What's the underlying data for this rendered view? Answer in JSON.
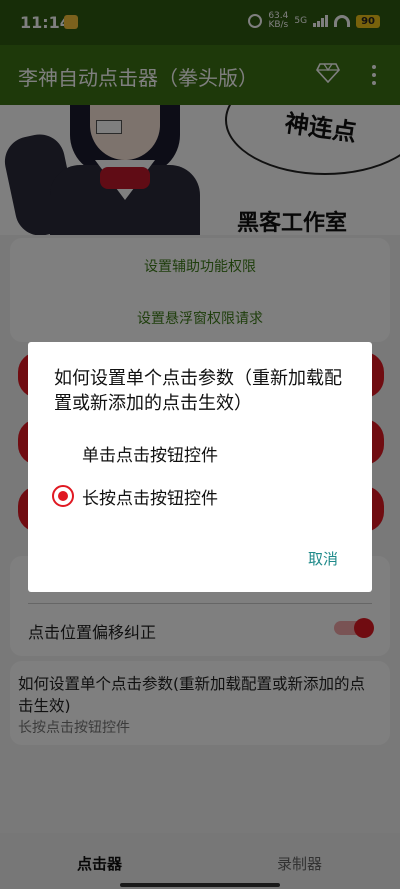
{
  "status_bar": {
    "time": "11:14",
    "speed": "63.4",
    "speed_unit": "KB/s",
    "network": "5G",
    "battery": "90"
  },
  "appbar": {
    "title": "李神自动点击器（拳头版）",
    "icons": [
      "diamond-icon",
      "more-vert-icon"
    ]
  },
  "banner": {
    "bubble_text": "神连点",
    "studio_text": "黑客工作室"
  },
  "permissions": {
    "accessibility": "设置辅助功能权限",
    "overlay": "设置悬浮窗权限请求"
  },
  "settings": {
    "offset_label": "点击位置偏移纠正",
    "offset_enabled": true
  },
  "info_card": {
    "title": "如何设置单个点击参数(重新加载配置或新添加的点击生效)",
    "value": "长按点击按钮控件"
  },
  "dialog": {
    "title": "如何设置单个点击参数（重新加载配置或新添加的点击生效）",
    "options": [
      "单击点击按钮控件",
      "长按点击按钮控件"
    ],
    "selected_index": 1,
    "cancel_label": "取消"
  },
  "bottom_nav": {
    "clicker": "点击器",
    "recorder": "录制器"
  },
  "colors": {
    "appbar": "#3d7314",
    "statusbar": "#2f5a10",
    "accent_red": "#e01922",
    "link_green": "#3f7d1a",
    "dialog_action": "#1f8a8a"
  }
}
